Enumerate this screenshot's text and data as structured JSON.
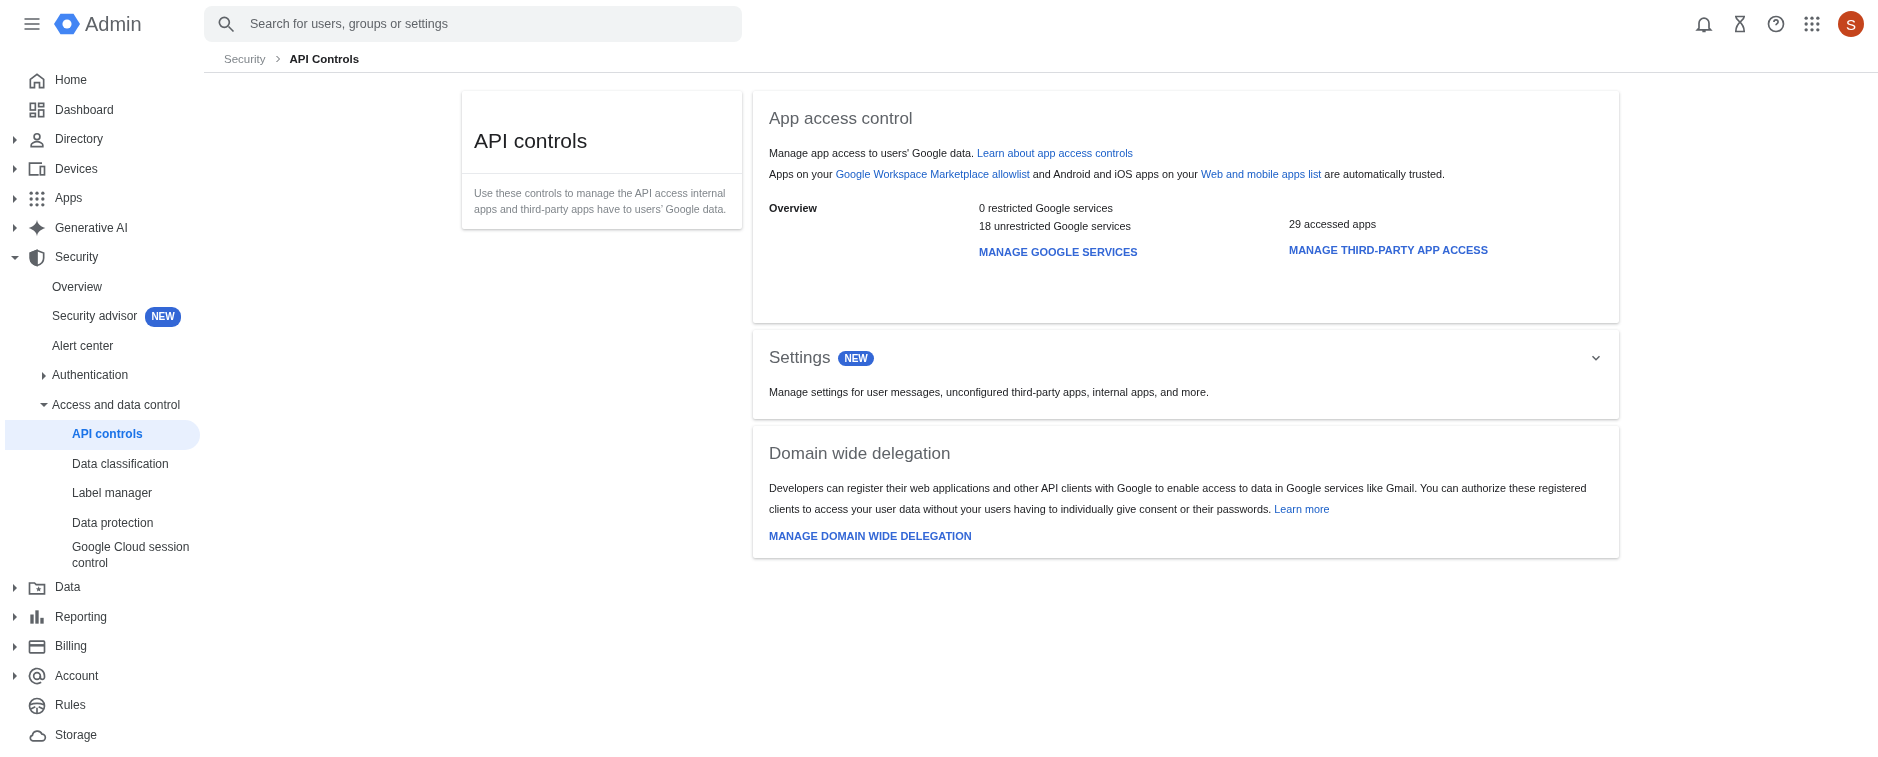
{
  "topbar": {
    "product": "Admin",
    "search": {
      "placeholder": "Search for users, groups or settings"
    },
    "avatar": "S"
  },
  "breadcrumb": [
    {
      "label": "Security",
      "current": false
    },
    {
      "label": "API Controls",
      "current": true
    }
  ],
  "sidebar": {
    "items": [
      {
        "label": "Home",
        "selected": false
      },
      {
        "label": "Dashboard",
        "selected": false
      },
      {
        "label": "Directory",
        "selected": false,
        "expanded": false
      },
      {
        "label": "Devices",
        "selected": false,
        "expanded": false
      },
      {
        "label": "Apps",
        "selected": false,
        "expanded": false
      },
      {
        "label": "Generative AI",
        "selected": false,
        "expanded": false
      },
      {
        "label": "Security",
        "selected": false,
        "expanded": true,
        "children": [
          {
            "label": "Overview",
            "selected": false
          },
          {
            "label": "Security advisor",
            "selected": false,
            "badge": "NEW"
          },
          {
            "label": "Alert center",
            "selected": false
          },
          {
            "label": "Authentication",
            "selected": false,
            "expanded": false
          },
          {
            "label": "Access and data control",
            "selected": false,
            "expanded": true,
            "children": [
              {
                "label": "API controls",
                "selected": true
              },
              {
                "label": "Data classification",
                "selected": false
              },
              {
                "label": "Label manager",
                "selected": false
              },
              {
                "label": "Data protection",
                "selected": false
              },
              {
                "label": "Google Cloud session control",
                "selected": false
              }
            ]
          }
        ]
      },
      {
        "label": "Data",
        "selected": false,
        "expanded": false
      },
      {
        "label": "Reporting",
        "selected": false,
        "expanded": false
      },
      {
        "label": "Billing",
        "selected": false,
        "expanded": false
      },
      {
        "label": "Account",
        "selected": false,
        "expanded": false
      },
      {
        "label": "Rules",
        "selected": false
      },
      {
        "label": "Storage",
        "selected": false
      }
    ]
  },
  "intro_card": {
    "title": "API controls",
    "description": "Use these controls to manage the API access internal apps and third-party apps have to users’ Google data."
  },
  "app_access": {
    "title": "App access control",
    "lines": [
      [
        {
          "text": "Manage app access to users' Google data. "
        },
        {
          "link": "Learn about app access controls"
        }
      ],
      [
        {
          "text": "Apps on your "
        },
        {
          "link": "Google Workspace Marketplace allowlist"
        },
        {
          "text": " and Android and iOS apps on your "
        },
        {
          "link": "Web and mobile apps list"
        },
        {
          "text": " are automatically trusted."
        }
      ]
    ],
    "overview": {
      "label": "Overview",
      "services": [
        "0 restricted Google services",
        "18 unrestricted Google services"
      ],
      "services_action": "MANAGE GOOGLE SERVICES",
      "apps": [
        "29 accessed apps"
      ],
      "apps_action": "MANAGE THIRD-PARTY APP ACCESS"
    }
  },
  "settings": {
    "title": "Settings",
    "badge": "NEW",
    "expanded": false,
    "description": "Manage settings for user messages, unconfigured third-party apps, internal apps, and more."
  },
  "delegation": {
    "title": "Domain wide delegation",
    "text": [
      {
        "text": "Developers can register their web applications and other API clients with Google to enable access to data in Google services like Gmail. You can authorize these registered clients to access your user data without your users having to individually give consent or their passwords. "
      },
      {
        "link": "Learn more"
      }
    ],
    "action": "MANAGE DOMAIN WIDE DELEGATION"
  }
}
